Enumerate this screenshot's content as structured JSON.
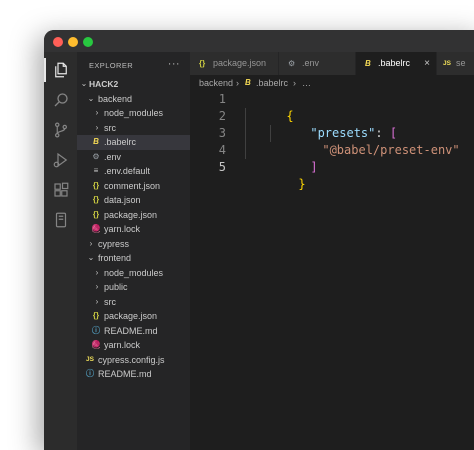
{
  "window": {
    "traffic_lights": {
      "red": "#ff5f57",
      "yellow": "#febc2e",
      "green": "#28c840"
    }
  },
  "activity_bar": {
    "icons": [
      "files-icon",
      "search-icon",
      "source-control-icon",
      "run-debug-icon",
      "extensions-icon",
      "remote-explorer-icon"
    ]
  },
  "sidebar": {
    "title": "EXPLORER",
    "more": "···",
    "workspace": "HACK2",
    "tree": [
      {
        "label": "backend",
        "type": "folder",
        "open": true
      },
      {
        "label": "node_modules",
        "type": "folder",
        "open": false
      },
      {
        "label": "src",
        "type": "folder",
        "open": false
      },
      {
        "label": ".babelrc",
        "type": "babel"
      },
      {
        "label": ".env",
        "type": "gear"
      },
      {
        "label": ".env.default",
        "type": "lines"
      },
      {
        "label": "comment.json",
        "type": "json"
      },
      {
        "label": "data.json",
        "type": "json"
      },
      {
        "label": "package.json",
        "type": "json"
      },
      {
        "label": "yarn.lock",
        "type": "yarn"
      },
      {
        "label": "cypress",
        "type": "folder",
        "open": false
      },
      {
        "label": "frontend",
        "type": "folder",
        "open": true
      },
      {
        "label": "node_modules",
        "type": "folder",
        "open": false
      },
      {
        "label": "public",
        "type": "folder",
        "open": false
      },
      {
        "label": "src",
        "type": "folder",
        "open": false
      },
      {
        "label": "package.json",
        "type": "json"
      },
      {
        "label": "README.md",
        "type": "info"
      },
      {
        "label": "yarn.lock",
        "type": "yarn"
      },
      {
        "label": "cypress.config.js",
        "type": "js"
      },
      {
        "label": "README.md",
        "type": "info"
      }
    ]
  },
  "tabs": [
    {
      "label": "package.json",
      "icon": "{}"
    },
    {
      "label": ".env",
      "icon": "⚙"
    },
    {
      "label": ".babelrc",
      "icon": "B",
      "close": "×"
    },
    {
      "label": "se",
      "icon": "JS"
    }
  ],
  "breadcrumb": {
    "folder": "backend",
    "sep": "›",
    "file": ".babelrc",
    "more": "…"
  },
  "editor": {
    "line_numbers": [
      "1",
      "2",
      "3",
      "4",
      "5"
    ],
    "code": {
      "l1_open": "{",
      "l2_key": "\"presets\"",
      "l2_colon": ": ",
      "l2_bracket": "[",
      "l3_value": "\"@babel/preset-env\"",
      "l4_bracket": "]",
      "l5_close": "}"
    }
  },
  "theme": {
    "editor_bg": "#1e1e1e",
    "sidebar_bg": "#252526",
    "activity_bg": "#2c2c2c",
    "string": "#ce9178",
    "key": "#9cdcfe",
    "brace": "#ffd700",
    "bracket": "#da70d6"
  }
}
